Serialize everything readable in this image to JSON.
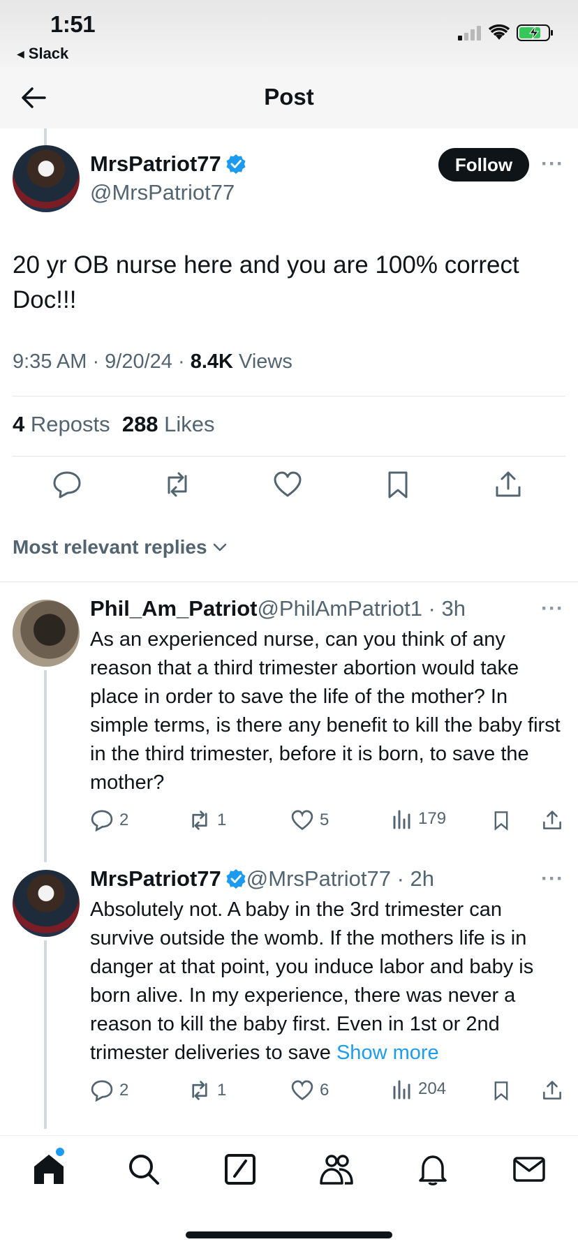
{
  "status_bar": {
    "time": "1:51",
    "back_app": "Slack"
  },
  "header": {
    "title": "Post"
  },
  "post": {
    "name": "MrsPatriot77",
    "handle": "@MrsPatriot77",
    "follow_label": "Follow",
    "text": "20 yr OB nurse here and you are 100% correct Doc!!!",
    "timestamp": "9:35 AM · 9/20/24 · ",
    "views_count": "8.4K",
    "views_label": " Views",
    "reposts_count": "4",
    "reposts_label": " Reposts",
    "likes_count": "288",
    "likes_label": " Likes"
  },
  "replies_filter": "Most relevant replies",
  "replies": [
    {
      "name": "Phil_Am_Patriot",
      "handle_time": " @PhilAmPatriot1 · 3h",
      "text": "As an experienced nurse, can you think of any reason that a third trimester abortion would take place in order to save the life of the mother? In simple terms, is there any benefit to kill the baby first in the third trimester, before it is born, to save the mother?",
      "replies": "2",
      "reposts": "1",
      "likes": "5",
      "views": "179"
    },
    {
      "name": "MrsPatriot77",
      "handle_time": " @MrsPatriot77 · 2h",
      "text": "Absolutely not. A baby in the 3rd trimester can survive outside the womb. If the mothers life is in danger at that point, you induce labor and baby is born alive. In my experience, there was never a reason to kill the baby first. Even in 1st or 2nd trimester deliveries to save ",
      "show_more": "Show more",
      "replies": "2",
      "reposts": "1",
      "likes": "6",
      "views": "204"
    }
  ],
  "colors": {
    "accent": "#1d9bf0",
    "text": "#0f1419",
    "secondary": "#536471"
  }
}
